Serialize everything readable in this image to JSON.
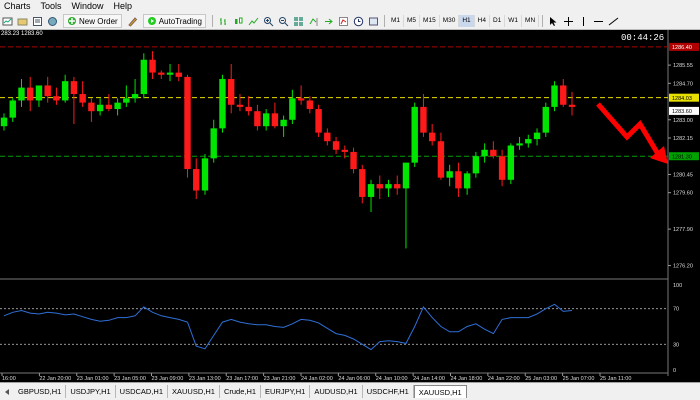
{
  "menu": [
    "Charts",
    "Tools",
    "Window",
    "Help"
  ],
  "toolbar": {
    "new_order_label": "New Order",
    "autotrading_label": "AutoTrading",
    "timeframes": [
      "M1",
      "M5",
      "M15",
      "M30",
      "H1",
      "H4",
      "D1",
      "W1",
      "MN"
    ],
    "active_timeframe": "H1"
  },
  "chart": {
    "info_text": "283.23 1283.60",
    "timer": "00:44:26",
    "price_labels": [
      "1285.55",
      "1284.70",
      "1283.00",
      "1282.15",
      "1280.45",
      "1279.60",
      "1277.90",
      "1276.20"
    ],
    "level_labels": {
      "top_red": "1286.40",
      "current": "1284.03",
      "current_second": "1283.60",
      "green": "1281.30"
    },
    "time_labels": [
      "16:00",
      "22 Jan 20:00",
      "23 Jan 01:00",
      "23 Jan 05:00",
      "23 Jan 09:00",
      "23 Jan 13:00",
      "23 Jan 17:00",
      "23 Jan 21:00",
      "24 Jan 02:00",
      "24 Jan 06:00",
      "24 Jan 10:00",
      "24 Jan 14:00",
      "24 Jan 18:00",
      "24 Jan 22:00",
      "25 Jan 03:00",
      "25 Jan 07:00",
      "25 Jan 11:00"
    ],
    "indicator_labels": [
      "100",
      "70",
      "30",
      "0"
    ]
  },
  "colors": {
    "bull": "#00e600",
    "bear": "#ff1a1a",
    "arrow": "#ff0000",
    "indicator_line": "#2f6fd6",
    "yellow_level": "#e8e000",
    "green_level": "#00a000",
    "red_level": "#b00000"
  },
  "chart_data": {
    "type": "candlestick",
    "candles": [
      [
        1282.7,
        1283.3,
        1282.5,
        1283.1
      ],
      [
        1283.1,
        1284.0,
        1282.9,
        1283.9
      ],
      [
        1283.9,
        1284.9,
        1283.6,
        1284.5
      ],
      [
        1284.5,
        1285.0,
        1283.4,
        1283.9
      ],
      [
        1283.9,
        1284.5,
        1283.6,
        1284.6
      ],
      [
        1284.6,
        1285.0,
        1283.8,
        1284.1
      ],
      [
        1284.1,
        1284.5,
        1283.7,
        1283.9
      ],
      [
        1283.9,
        1285.1,
        1283.8,
        1284.8
      ],
      [
        1284.8,
        1285.0,
        1282.8,
        1284.2
      ],
      [
        1284.2,
        1284.8,
        1283.6,
        1283.8
      ],
      [
        1283.8,
        1284.0,
        1282.9,
        1283.4
      ],
      [
        1283.4,
        1284.0,
        1283.2,
        1283.7
      ],
      [
        1283.7,
        1284.2,
        1283.4,
        1283.5
      ],
      [
        1283.5,
        1284.0,
        1283.2,
        1283.8
      ],
      [
        1283.8,
        1284.6,
        1283.6,
        1284.0
      ],
      [
        1284.0,
        1284.9,
        1283.8,
        1284.2
      ],
      [
        1284.2,
        1286.1,
        1284.0,
        1285.8
      ],
      [
        1285.8,
        1286.2,
        1284.9,
        1285.2
      ],
      [
        1285.2,
        1285.3,
        1284.9,
        1285.1
      ],
      [
        1285.1,
        1285.6,
        1284.8,
        1285.2
      ],
      [
        1285.2,
        1285.6,
        1284.8,
        1285.0
      ],
      [
        1285.0,
        1285.1,
        1280.3,
        1280.7
      ],
      [
        1280.7,
        1281.2,
        1279.3,
        1279.7
      ],
      [
        1279.7,
        1281.4,
        1279.5,
        1281.2
      ],
      [
        1281.2,
        1283.0,
        1281.0,
        1282.6
      ],
      [
        1282.6,
        1285.1,
        1282.4,
        1284.9
      ],
      [
        1284.9,
        1285.6,
        1283.3,
        1283.7
      ],
      [
        1283.7,
        1284.2,
        1283.4,
        1283.6
      ],
      [
        1283.6,
        1284.1,
        1283.2,
        1283.4
      ],
      [
        1283.4,
        1283.7,
        1282.5,
        1282.7
      ],
      [
        1282.7,
        1283.5,
        1282.5,
        1283.3
      ],
      [
        1283.3,
        1283.8,
        1282.6,
        1282.7
      ],
      [
        1282.7,
        1283.2,
        1282.2,
        1283.0
      ],
      [
        1283.0,
        1284.4,
        1282.8,
        1284.0
      ],
      [
        1284.0,
        1284.6,
        1283.7,
        1283.9
      ],
      [
        1283.9,
        1284.1,
        1283.3,
        1283.5
      ],
      [
        1283.5,
        1283.7,
        1282.2,
        1282.4
      ],
      [
        1282.4,
        1282.6,
        1281.8,
        1282.0
      ],
      [
        1282.0,
        1282.2,
        1281.4,
        1281.6
      ],
      [
        1281.6,
        1281.8,
        1281.2,
        1281.5
      ],
      [
        1281.5,
        1281.7,
        1280.5,
        1280.7
      ],
      [
        1280.7,
        1280.9,
        1279.1,
        1279.4
      ],
      [
        1279.4,
        1280.2,
        1278.7,
        1280.0
      ],
      [
        1280.0,
        1280.4,
        1279.3,
        1279.8
      ],
      [
        1279.8,
        1280.2,
        1279.4,
        1280.0
      ],
      [
        1280.0,
        1280.4,
        1279.5,
        1279.8
      ],
      [
        1279.8,
        1281.0,
        1277.0,
        1281.0
      ],
      [
        1281.0,
        1283.8,
        1280.8,
        1283.6
      ],
      [
        1283.6,
        1284.2,
        1282.2,
        1282.4
      ],
      [
        1282.4,
        1282.8,
        1281.8,
        1282.0
      ],
      [
        1282.0,
        1282.4,
        1280.2,
        1280.3
      ],
      [
        1280.3,
        1280.9,
        1279.9,
        1280.6
      ],
      [
        1280.6,
        1281.0,
        1279.4,
        1279.8
      ],
      [
        1279.8,
        1280.6,
        1279.5,
        1280.5
      ],
      [
        1280.5,
        1281.5,
        1280.3,
        1281.3
      ],
      [
        1281.3,
        1281.9,
        1281.0,
        1281.6
      ],
      [
        1281.6,
        1282.0,
        1281.2,
        1281.3
      ],
      [
        1281.3,
        1281.6,
        1279.9,
        1280.2
      ],
      [
        1280.2,
        1281.9,
        1280.0,
        1281.8
      ],
      [
        1281.8,
        1282.2,
        1281.6,
        1281.9
      ],
      [
        1281.9,
        1282.3,
        1281.7,
        1282.1
      ],
      [
        1282.1,
        1282.6,
        1281.8,
        1282.4
      ],
      [
        1282.4,
        1283.8,
        1282.2,
        1283.6
      ],
      [
        1283.6,
        1284.8,
        1283.4,
        1284.6
      ],
      [
        1284.6,
        1284.9,
        1283.6,
        1283.7
      ],
      [
        1283.7,
        1284.3,
        1283.2,
        1283.6
      ]
    ],
    "indicator": [
      62,
      66,
      68,
      65,
      64,
      66,
      65,
      63,
      64,
      61,
      58,
      56,
      57,
      60,
      60,
      62,
      72,
      66,
      62,
      60,
      58,
      55,
      28,
      25,
      40,
      55,
      58,
      55,
      53,
      52,
      52,
      50,
      49,
      53,
      58,
      57,
      54,
      48,
      42,
      40,
      36,
      30,
      24,
      33,
      34,
      33,
      31,
      50,
      72,
      60,
      50,
      44,
      44,
      50,
      53,
      47,
      42,
      58,
      60,
      60,
      60,
      64,
      70,
      75,
      67,
      68
    ],
    "price_range": [
      1275.9,
      1287.0
    ],
    "indicator_range": [
      0,
      100
    ],
    "indicator_levels": [
      70,
      30
    ]
  },
  "tabs": [
    "GBPUSD,H1",
    "USDJPY,H1",
    "USDCAD,H1",
    "XAUUSD,H1",
    "Crude,H1",
    "EURJPY,H1",
    "AUDUSD,H1",
    "USDCHF,H1",
    "XAUUSD,H1"
  ],
  "active_tab_index": 8
}
